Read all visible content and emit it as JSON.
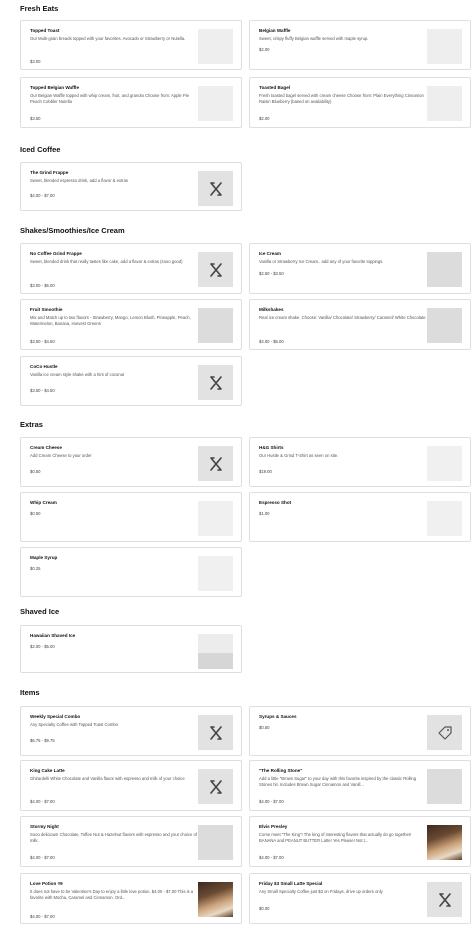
{
  "sections": [
    {
      "title": "Fresh Eats",
      "items": [
        {
          "name": "Topped Toast",
          "desc": "Our Multi-grain breads topped with your favorites. Avocado or Strawberry or Nutella.",
          "price": "$3.00",
          "thumb": "placeholder"
        },
        {
          "name": "Belgian Waffle",
          "desc": "Sweet, crispy fluffy Belgian waffle served with maple syrup.",
          "price": "$2.00",
          "thumb": "placeholder"
        },
        {
          "name": "Topped Belgian Waffle",
          "desc": "Our Belgian Waffle topped with whip cream, fruit, and granola Choose from: Apple Pie Peach Cobbler Nutella",
          "price": "$3.50",
          "thumb": "placeholder"
        },
        {
          "name": "Toasted Bagel",
          "desc": "Fresh toasted bagel served with cream cheese Choose from: Plain Everything Cinnamon Raisin Blueberry (based on availability)",
          "price": "$2.00",
          "thumb": "placeholder"
        }
      ]
    },
    {
      "title": "Iced Coffee",
      "items": [
        {
          "name": "The Grind Frappe",
          "desc": "Sweet, blended espresso drink, add a flavor & extras",
          "price": "$4.00 - $7.00",
          "thumb": "utensils-icon"
        }
      ]
    },
    {
      "title": "Shakes/Smoothies/Ice Cream",
      "items": [
        {
          "name": "No Coffee Grind Frappe",
          "desc": "Sweet, blended drink that really tastes like cake, add a flavor & extras (sooo good)",
          "price": "$3.00 - $6.00",
          "thumb": "utensils-icon"
        },
        {
          "name": "Ice Cream",
          "desc": "Vanilla or Strawberry Ice Cream.. add any of your favorite toppings.",
          "price": "$2.50 - $3.50",
          "thumb": "placeholder"
        },
        {
          "name": "Fruit Smoothie",
          "desc": "Mix and Match up to two flavors - Strawberry, Mango, Lemon Blush, Pineapple, Peach, Watermelon, Banana, Harvest Greens",
          "price": "$3.50 - $4.50",
          "thumb": "placeholder"
        },
        {
          "name": "Milkshakes",
          "desc": "Real ice cream shake. Choose: Vanilla/ Chocolate/ Strawberry/ Caramel/ White Chocolate",
          "price": "$4.00 - $5.00",
          "thumb": "placeholder"
        },
        {
          "name": "CoCo Hustle",
          "desc": "Vanilla ice cream style shake with a hint of coconut",
          "price": "$3.50 - $4.50",
          "thumb": "utensils-icon"
        }
      ]
    },
    {
      "title": "Extras",
      "items": [
        {
          "name": "Cream Cheese",
          "desc": "Add Cream Cheese to your order",
          "price": "$0.50",
          "thumb": "utensils-icon"
        },
        {
          "name": "H&G Shirts",
          "desc": "Our Hustle & Grind T-Shirt as seen on site.",
          "price": "$19.00",
          "thumb": "light"
        },
        {
          "name": "Whip Cream",
          "desc": "",
          "price": "$0.50",
          "thumb": "light"
        },
        {
          "name": "Espresso Shot",
          "desc": "",
          "price": "$1.00",
          "thumb": "light"
        },
        {
          "name": "Maple Syrup",
          "desc": "",
          "price": "$0.25",
          "thumb": "light"
        }
      ]
    },
    {
      "title": "Shaved Ice",
      "items": [
        {
          "name": "Hawaiian Shaved Ice",
          "desc": "",
          "price": "$2.00 - $5.00",
          "thumb": "split"
        }
      ]
    },
    {
      "title": "Items",
      "items": [
        {
          "name": "Weekly Special Combo",
          "desc": "Any Specialty Coffee with Topped Toast Combo",
          "price": "$6.75 - $9.75",
          "thumb": "utensils-icon"
        },
        {
          "name": "Syrups & Sauces",
          "desc": "",
          "price": "$0.50",
          "thumb": "tag-icon"
        },
        {
          "name": "King Cake Latte",
          "desc": "Ghirardelli White Chocolate and Vanilla flavor with espresso and milk of your choice",
          "price": "$4.00 - $7.00",
          "thumb": "utensils-icon"
        },
        {
          "name": "\"The Rolling Stone\"",
          "desc": "Add a little \"Brown Sugar\" to your day with this favorite inspired by the classic Rolling Stones hit. Includes Brown Sugar Cinnamon and Vanill...",
          "price": "$4.00 - $7.00",
          "thumb": "placeholder"
        },
        {
          "name": "Stormy Night",
          "desc": "Sooo delicious! Chocolate, Toffee Nut & Hazelnut flavors with espresso and your choice of milk.",
          "price": "$4.00 - $7.00",
          "thumb": "placeholder"
        },
        {
          "name": "Elvis Presley",
          "desc": "Come meet \"The King\"! The king of interesting flavors that actually do go together! BANANA and PEANUT BUTTER Latte! Yes Please! Not t...",
          "price": "$4.00 - $7.00",
          "thumb": "photo"
        },
        {
          "name": "Love Potion #9",
          "desc": "It does not have to be Valentine's Day to enjoy a little love potion. $4.00 - $7.00 This is a favorite with Mocha, Caramel and Cinnamon. Ord...",
          "price": "$4.00 - $7.00",
          "thumb": "photo"
        },
        {
          "name": "Friday $3 Small Latte Special",
          "desc": "Any Small Specialty Coffee just $3 on Fridays, drive up orders only",
          "price": "$0.00",
          "thumb": "utensils-icon"
        }
      ]
    }
  ]
}
